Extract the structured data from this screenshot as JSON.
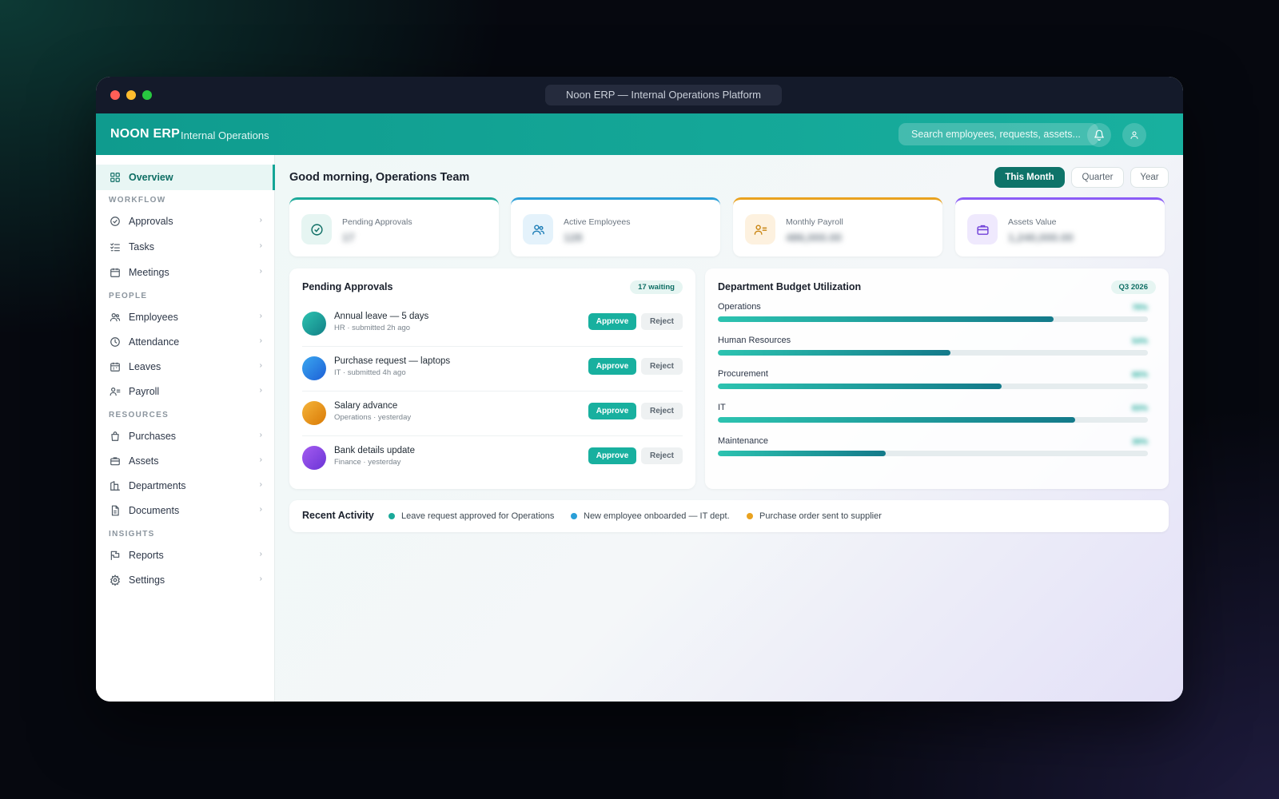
{
  "window": {
    "title": "Noon ERP — Internal Operations Platform"
  },
  "appbar": {
    "brand": "NOON ERP",
    "subtitle": "Internal Operations",
    "search_placeholder": "Search employees, requests, assets..."
  },
  "sidebar": {
    "overview": "Overview",
    "sections": {
      "workflow": "WORKFLOW",
      "people": "PEOPLE",
      "resources": "RESOURCES",
      "insights": "INSIGHTS"
    },
    "items": {
      "approvals": "Approvals",
      "tasks": "Tasks",
      "meetings": "Meetings",
      "employees": "Employees",
      "attendance": "Attendance",
      "leaves": "Leaves",
      "payroll": "Payroll",
      "purchases": "Purchases",
      "assets": "Assets",
      "departments": "Departments",
      "documents": "Documents",
      "reports": "Reports",
      "settings": "Settings"
    },
    "chevron": "›"
  },
  "main": {
    "greeting": "Good morning, Operations Team",
    "periods": {
      "month": "This Month",
      "quarter": "Quarter",
      "year": "Year"
    },
    "kpis": [
      {
        "label": "Pending Approvals",
        "value": "17",
        "color": "#1aa999"
      },
      {
        "label": "Active Employees",
        "value": "128",
        "color": "#2a9fd8"
      },
      {
        "label": "Monthly Payroll",
        "value": "486,000.00",
        "color": "#e9a21f"
      },
      {
        "label": "Assets Value",
        "value": "1,240,000.00",
        "color": "#8b5cf6"
      }
    ],
    "approvals": {
      "title": "Pending Approvals",
      "badge": "17 waiting",
      "approve_label": "Approve",
      "reject_label": "Reject",
      "items": [
        {
          "title": "Annual leave — 5 days",
          "sub": "HR · submitted 2h ago"
        },
        {
          "title": "Purchase request — laptops",
          "sub": "IT · submitted 4h ago"
        },
        {
          "title": "Salary advance",
          "sub": "Operations · yesterday"
        },
        {
          "title": "Bank details update",
          "sub": "Finance · yesterday"
        }
      ]
    },
    "budget": {
      "title": "Department Budget Utilization",
      "badge": "Q3 2026",
      "items": [
        {
          "name": "Operations",
          "pct": 78,
          "label": "78%"
        },
        {
          "name": "Human Resources",
          "pct": 54,
          "label": "54%"
        },
        {
          "name": "Procurement",
          "pct": 66,
          "label": "66%"
        },
        {
          "name": "IT",
          "pct": 83,
          "label": "83%"
        },
        {
          "name": "Maintenance",
          "pct": 39,
          "label": "39%"
        }
      ]
    },
    "activity": {
      "title": "Recent Activity",
      "items": [
        {
          "text": "Leave request approved for Operations",
          "color": "#1aa999"
        },
        {
          "text": "New employee onboarded — IT dept.",
          "color": "#2a9fd8"
        },
        {
          "text": "Purchase order sent to supplier",
          "color": "#e9a21f"
        }
      ]
    }
  }
}
